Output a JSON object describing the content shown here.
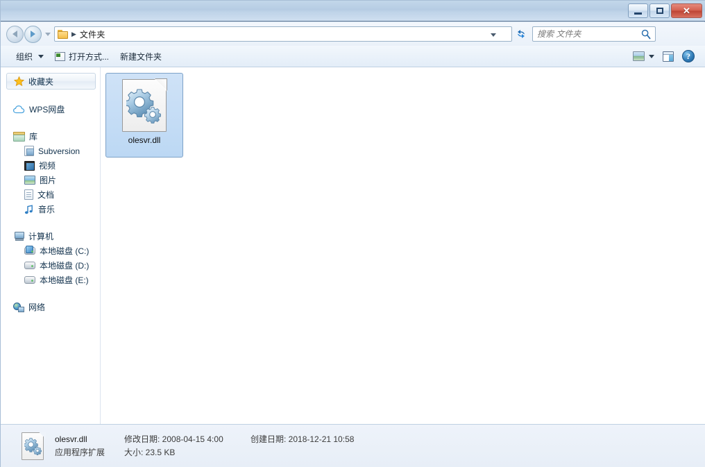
{
  "window": {
    "titlebar": {
      "minimize_label": "最小化",
      "maximize_label": "最大化",
      "close_label": "关闭",
      "close_glyph": "✕"
    }
  },
  "address_bar": {
    "back_tooltip": "后退",
    "forward_tooltip": "前进",
    "history_tooltip": "最近浏览的位置",
    "folder_icon": "folder-icon",
    "separator": "▶",
    "path_text": "文件夹",
    "dropdown_icon": "chevron-down-icon",
    "refresh_tooltip": "刷新",
    "search": {
      "value": "",
      "placeholder": "搜索 文件夹",
      "icon": "search-icon"
    }
  },
  "toolbar": {
    "organize_label": "组织",
    "organize_caret": "chevron-down-icon",
    "open_with_label": "打开方式...",
    "open_with_icon": "open-with-icon",
    "new_folder_label": "新建文件夹",
    "view_icon": "view-options-icon",
    "view_caret": "chevron-down-icon",
    "preview_pane_icon": "preview-pane-icon",
    "help_icon": "help-icon",
    "help_glyph": "?"
  },
  "sidebar": {
    "favorites": {
      "label": "收藏夹",
      "icon": "star-icon"
    },
    "wps": {
      "label": "WPS网盘",
      "icon": "cloud-icon"
    },
    "library": {
      "label": "库",
      "icon": "library-icon"
    },
    "library_items": [
      {
        "label": "Subversion",
        "icon": "subversion-icon"
      },
      {
        "label": "视频",
        "icon": "video-icon"
      },
      {
        "label": "图片",
        "icon": "picture-icon"
      },
      {
        "label": "文档",
        "icon": "document-icon"
      },
      {
        "label": "音乐",
        "icon": "music-icon"
      }
    ],
    "computer": {
      "label": "计算机",
      "icon": "computer-icon"
    },
    "drives": [
      {
        "label": "本地磁盘 (C:)",
        "icon": "system-drive-icon"
      },
      {
        "label": "本地磁盘 (D:)",
        "icon": "drive-icon"
      },
      {
        "label": "本地磁盘 (E:)",
        "icon": "drive-icon"
      }
    ],
    "network": {
      "label": "网络",
      "icon": "network-icon"
    }
  },
  "content": {
    "files": [
      {
        "name": "olesvr.dll",
        "icon": "dll-file-icon",
        "selected": true
      }
    ]
  },
  "status_bar": {
    "icon": "dll-file-icon",
    "file_name": "olesvr.dll",
    "file_type": "应用程序扩展",
    "modified_label": "修改日期: 2008-04-15 4:00",
    "created_label": "创建日期: 2018-12-21 10:58",
    "size_label": "大小: 23.5 KB"
  },
  "colors": {
    "titlebar_top": "#c3d7ea",
    "titlebar_bottom": "#cfdff0",
    "close_button": "#c9503f",
    "selection": "#c2dbf5",
    "selection_border": "#7da2c8",
    "sidebar_text": "#12324d",
    "status_bg": "#eef3fa"
  }
}
